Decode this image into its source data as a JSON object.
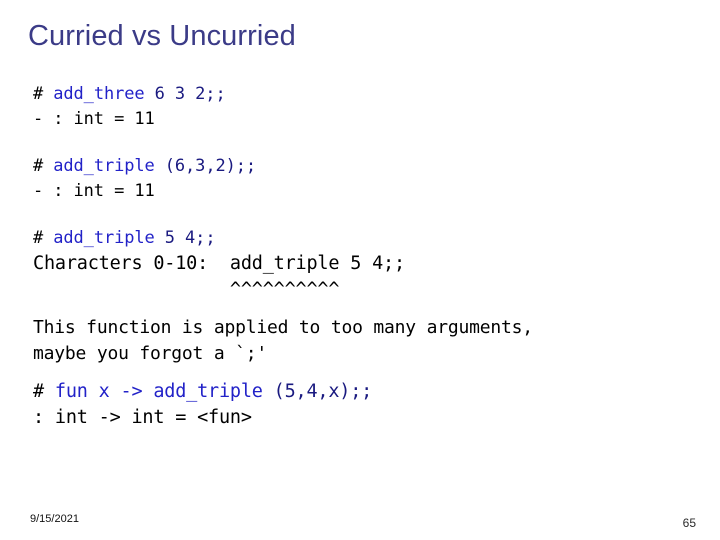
{
  "slide": {
    "title": "Curried vs Uncurried",
    "colors": {
      "title": "#3b3b87",
      "code_identifier": "#2222c8",
      "code_argument": "#1a1a80",
      "plain_text": "#000000",
      "background": "#ffffff"
    }
  },
  "blocks": [
    {
      "name": "add-three-interaction",
      "prompt": {
        "marker": "# ",
        "identifier": "add_three",
        "arguments": " 6 3 2;;"
      },
      "reply": "- : int = 11"
    },
    {
      "name": "add-triple-tuple-interaction",
      "prompt": {
        "marker": "# ",
        "identifier": "add_triple",
        "arguments": " (6,3,2);;"
      },
      "reply": "- : int = 11"
    },
    {
      "name": "add-triple-error-interaction",
      "prompt": {
        "marker": "# ",
        "identifier": "add_triple",
        "arguments": " 5 4;;"
      },
      "error_echo": "Characters 0-10:  add_triple 5 4;;",
      "error_carets": "                  ^^^^^^^^^^",
      "error_message_line1": "This function is applied to too many arguments,",
      "error_message_line2": "maybe you forgot a `;'"
    },
    {
      "name": "fun-lambda-interaction",
      "prompt": {
        "marker": "# ",
        "identifier": "fun x -> add_triple",
        "arguments": " (5,4,x);;"
      },
      "reply": ": int -> int = <fun>"
    }
  ],
  "footer": {
    "date": "9/15/2021",
    "page_number": "65"
  }
}
